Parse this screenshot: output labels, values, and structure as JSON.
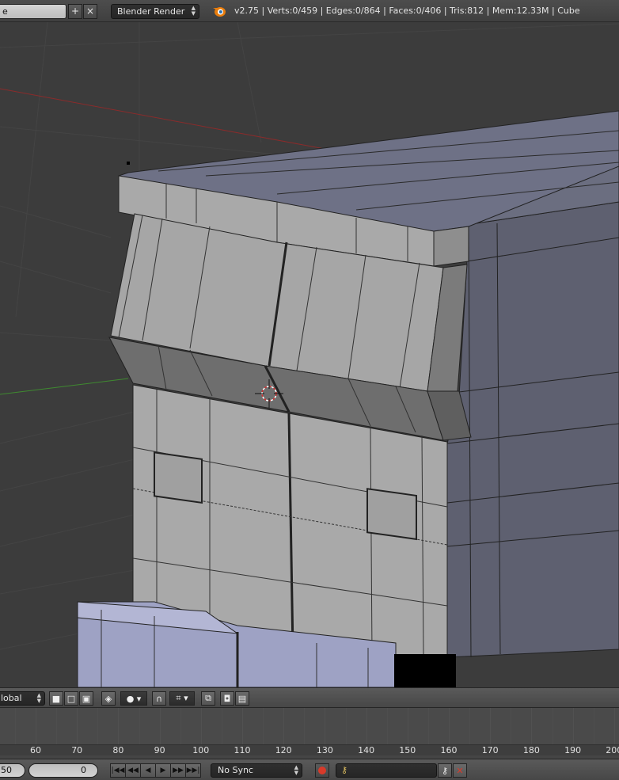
{
  "info_header": {
    "scene_name": "e",
    "render_engine": "Blender Render",
    "stats": "v2.75 | Verts:0/459 | Edges:0/864 | Faces:0/406 | Tris:812 | Mem:12.33M | Cube"
  },
  "view3d_header": {
    "orientation": "lobal",
    "icons": [
      "solid-shading-icon",
      "wire-shading-icon",
      "texture-shading-icon",
      "pivot-icon",
      "proportional-icon",
      "snap-icon",
      "render-icon"
    ]
  },
  "timeline": {
    "frame_ticks": [
      "60",
      "70",
      "80",
      "90",
      "100",
      "110",
      "120",
      "130",
      "140",
      "150",
      "160",
      "170",
      "180",
      "190",
      "200"
    ]
  },
  "timeline_header": {
    "start_frame": "50",
    "current_frame": "0",
    "sync_mode": "No Sync"
  },
  "colors": {
    "viewport_bg": "#3c3c3c",
    "mesh_light": "#a9a9a9",
    "mesh_side": "#5e6070",
    "mesh_selected_floor": "#9ea2c4",
    "x_axis": "#8a2b2b",
    "y_axis": "#3f8a30"
  }
}
